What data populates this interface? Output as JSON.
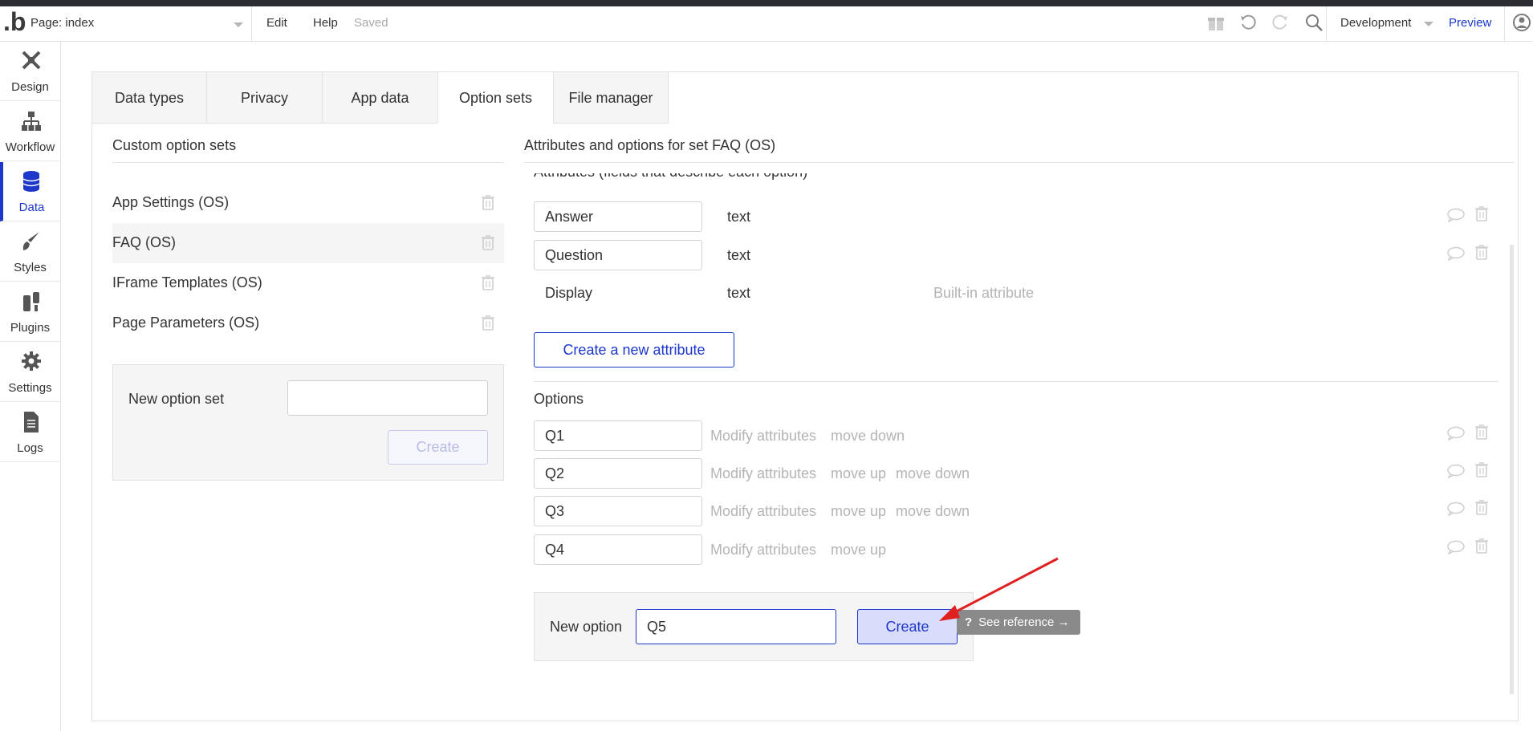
{
  "header": {
    "page_label": "Page: index",
    "menu_edit": "Edit",
    "menu_help": "Help",
    "status": "Saved",
    "environment": "Development",
    "preview": "Preview",
    "icons": [
      "gift-icon",
      "undo-icon",
      "redo-icon",
      "search-icon",
      "user-icon"
    ]
  },
  "sidebar": {
    "items": [
      {
        "label": "Design",
        "icon": "design-icon"
      },
      {
        "label": "Workflow",
        "icon": "workflow-icon"
      },
      {
        "label": "Data",
        "icon": "database-icon",
        "active": true
      },
      {
        "label": "Styles",
        "icon": "brush-icon"
      },
      {
        "label": "Plugins",
        "icon": "plug-icon"
      },
      {
        "label": "Settings",
        "icon": "gear-icon"
      },
      {
        "label": "Logs",
        "icon": "document-icon"
      }
    ]
  },
  "tabs": [
    {
      "label": "Data types"
    },
    {
      "label": "Privacy"
    },
    {
      "label": "App data"
    },
    {
      "label": "Option sets",
      "active": true
    },
    {
      "label": "File manager"
    }
  ],
  "left": {
    "title": "Custom option sets",
    "option_sets": [
      {
        "name": "App Settings (OS)"
      },
      {
        "name": "FAQ (OS)",
        "selected": true
      },
      {
        "name": "IFrame Templates (OS)"
      },
      {
        "name": "Page Parameters (OS)"
      }
    ],
    "new_option_set_label": "New option set",
    "new_option_set_value": "",
    "create_label": "Create"
  },
  "right": {
    "title": "Attributes and options for set FAQ (OS)",
    "attributes_heading_cut": "Attributes (fields that describe each option)",
    "attributes": [
      {
        "name": "Answer",
        "type": "text"
      },
      {
        "name": "Question",
        "type": "text"
      },
      {
        "name": "Display",
        "type": "text",
        "note": "Built-in attribute"
      }
    ],
    "create_attribute_label": "Create a new attribute",
    "options_title": "Options",
    "options": [
      {
        "name": "Q1",
        "actions": [
          "Modify attributes",
          "move down"
        ]
      },
      {
        "name": "Q2",
        "actions": [
          "Modify attributes",
          "move up",
          "move down"
        ]
      },
      {
        "name": "Q3",
        "actions": [
          "Modify attributes",
          "move up",
          "move down"
        ]
      },
      {
        "name": "Q4",
        "actions": [
          "Modify attributes",
          "move up"
        ]
      }
    ],
    "new_option_label": "New option",
    "new_option_value": "Q5",
    "create_label": "Create",
    "see_reference": "See reference →",
    "accent_color": "#1c37c9"
  }
}
